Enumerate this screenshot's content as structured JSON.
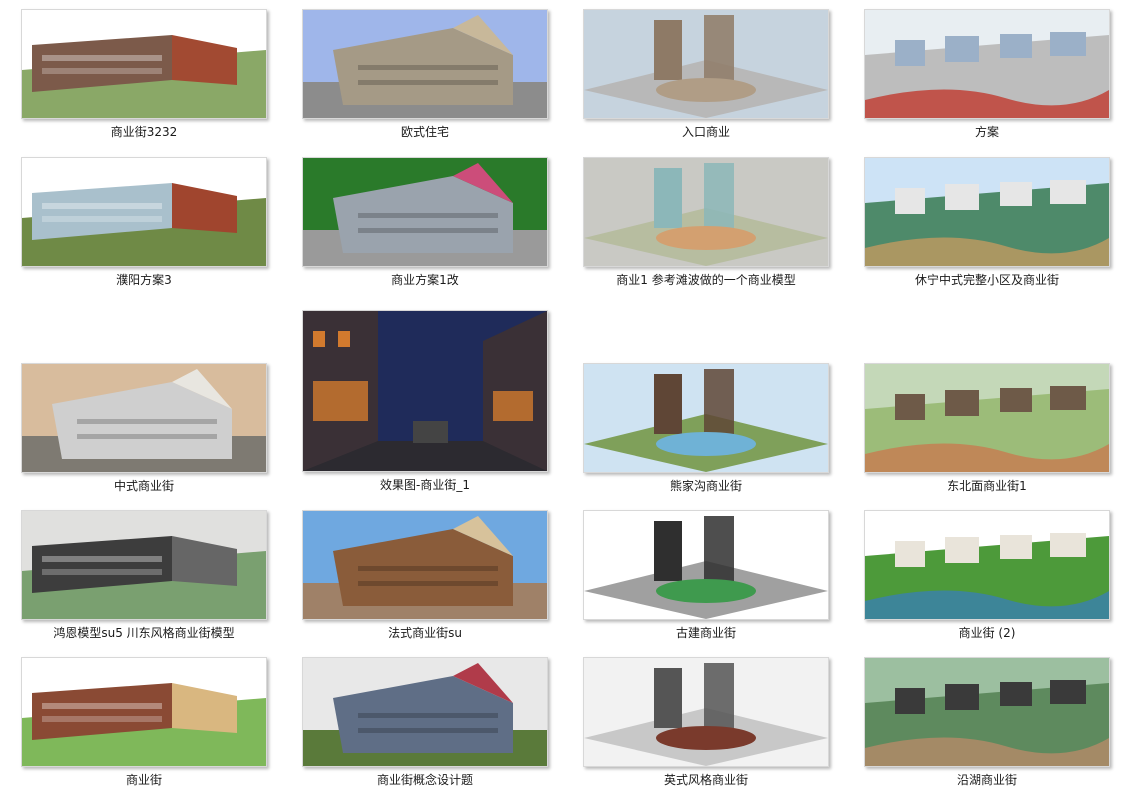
{
  "items": [
    {
      "label": "商业街3232",
      "sky": "#ffffff",
      "ground": "#8aa867",
      "accent": "#a24a32",
      "building": "#7c5a4a"
    },
    {
      "label": "欧式住宅",
      "sky": "#9fb6ea",
      "ground": "#8c8c8c",
      "accent": "#c8b89a",
      "building": "#a59a86"
    },
    {
      "label": "入口商业",
      "sky": "#c6d3de",
      "ground": "#b8b8b8",
      "accent": "#b09d86",
      "building": "#8e7a66"
    },
    {
      "label": "方案",
      "sky": "#e8eef2",
      "ground": "#bdbdbd",
      "accent": "#c03a2e",
      "building": "#9bb0c8"
    },
    {
      "label": "濮阳方案3",
      "sky": "#ffffff",
      "ground": "#6f8a46",
      "accent": "#a0452e",
      "building": "#a9c0cc"
    },
    {
      "label": "商业方案1改",
      "sky": "#2a7a2a",
      "ground": "#9a9a9a",
      "accent": "#cc4d7a",
      "building": "#9aa3ad"
    },
    {
      "label": "商业1 参考滩波做的一个商业模型",
      "sky": "#c9c9c4",
      "ground": "#b7bda0",
      "accent": "#d3a070",
      "building": "#8cb7b9"
    },
    {
      "label": "休宁中式完整小区及商业街",
      "sky": "#cde3f6",
      "ground": "#4e8a6a",
      "accent": "#c29a60",
      "building": "#e6e6e6"
    },
    {
      "label": "效果图-商业街_1",
      "sky": "#1f2b5a",
      "ground": "#2c2a30",
      "accent": "#d27a2e",
      "building": "#3a3036"
    },
    {
      "label": "中式商业街",
      "sky": "#d8bc9d",
      "ground": "#7e7a72",
      "accent": "#e8e6e0",
      "building": "#cfcfcf"
    },
    {
      "label": "熊家沟商业街",
      "sky": "#cfe3f2",
      "ground": "#7fa05a",
      "accent": "#6fb2d6",
      "building": "#5f4636"
    },
    {
      "label": "东北面商业街1",
      "sky": "#c4d8b8",
      "ground": "#9cbc79",
      "accent": "#c87a50",
      "building": "#6e5a48"
    },
    {
      "label": "鸿恩模型su5 川东风格商业街模型",
      "sky": "#e0e0de",
      "ground": "#7aa070",
      "accent": "#666666",
      "building": "#3d3d3d"
    },
    {
      "label": "法式商业街su",
      "sky": "#6fa8e0",
      "ground": "#9f8168",
      "accent": "#d7c29b",
      "building": "#8a5c3a"
    },
    {
      "label": "古建商业街",
      "sky": "#ffffff",
      "ground": "#a0a0a0",
      "accent": "#3f9a4e",
      "building": "#2f2f2f"
    },
    {
      "label": "商业街 (2)",
      "sky": "#ffffff",
      "ground": "#4d9a3a",
      "accent": "#3a7fb0",
      "building": "#e9e4da"
    },
    {
      "label": "商业街",
      "sky": "#ffffff",
      "ground": "#7fb85a",
      "accent": "#d9b780",
      "building": "#8a4a34"
    },
    {
      "label": "商业街概念设计题",
      "sky": "#e8e8e8",
      "ground": "#5a7a3a",
      "accent": "#b03b4a",
      "building": "#5f6e86"
    },
    {
      "label": "英式风格商业街",
      "sky": "#f2f2f2",
      "ground": "#c8c8c8",
      "accent": "#7a3a2c",
      "building": "#555555"
    },
    {
      "label": "沿湖商业街",
      "sky": "#9cbfa0",
      "ground": "#5e8a5e",
      "accent": "#b58a68",
      "building": "#3a3a3a"
    }
  ]
}
